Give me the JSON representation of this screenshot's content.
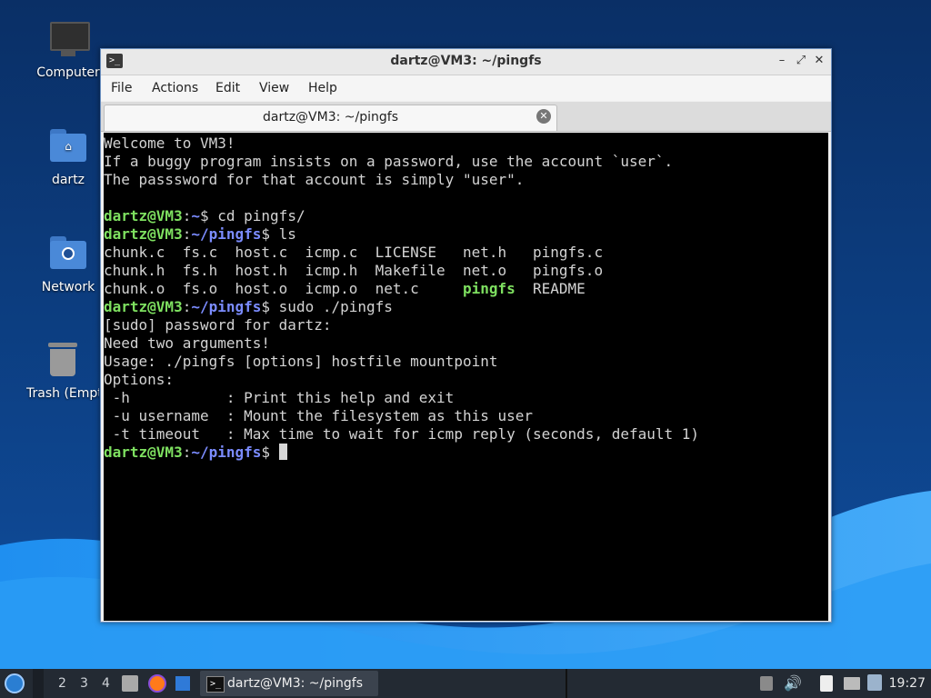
{
  "colors": {
    "desktop_bg": "#0b3a78",
    "terminal_bg": "#000000",
    "prompt_user": "#7ee060",
    "prompt_path": "#7b8cff",
    "exec_file": "#7ee060"
  },
  "desktop": {
    "icons": [
      {
        "label": "Computer",
        "icon": "monitor-icon"
      },
      {
        "label": "dartz",
        "icon": "home-folder-icon"
      },
      {
        "label": "Network",
        "icon": "network-folder-icon"
      },
      {
        "label": "Trash (Empty)",
        "icon": "trash-icon"
      }
    ]
  },
  "window": {
    "title": "dartz@VM3: ~/pingfs",
    "menu": [
      "File",
      "Actions",
      "Edit",
      "View",
      "Help"
    ],
    "tab_title": "dartz@VM3: ~/pingfs"
  },
  "terminal": {
    "prompt_user": "dartz@VM3",
    "lines": [
      "Welcome to VM3!",
      "If a buggy program insists on a password, use the account `user`.",
      "The passsword for that account is simply \"user\".",
      "",
      {
        "path": "~",
        "cmd": " cd pingfs/"
      },
      {
        "path": "~/pingfs",
        "cmd": " ls"
      },
      "chunk.c  fs.c  host.c  icmp.c  LICENSE   net.h   pingfs.c",
      "chunk.h  fs.h  host.h  icmp.h  Makefile  net.o   pingfs.o",
      {
        "pre": "chunk.o  fs.o  host.o  icmp.o  net.c     ",
        "exec": "pingfs",
        "post": "  README"
      },
      {
        "path": "~/pingfs",
        "cmd": " sudo ./pingfs"
      },
      "[sudo] password for dartz:",
      "Need two arguments!",
      "Usage: ./pingfs [options] hostfile mountpoint",
      "Options:",
      " -h           : Print this help and exit",
      " -u username  : Mount the filesystem as this user",
      " -t timeout   : Max time to wait for icmp reply (seconds, default 1)",
      {
        "path": "~/pingfs",
        "cmd": " ",
        "cursor": true
      }
    ]
  },
  "taskbar": {
    "workspaces": [
      "2",
      "3",
      "4"
    ],
    "task_label": "dartz@VM3: ~/pingfs",
    "clock": "19:27"
  }
}
